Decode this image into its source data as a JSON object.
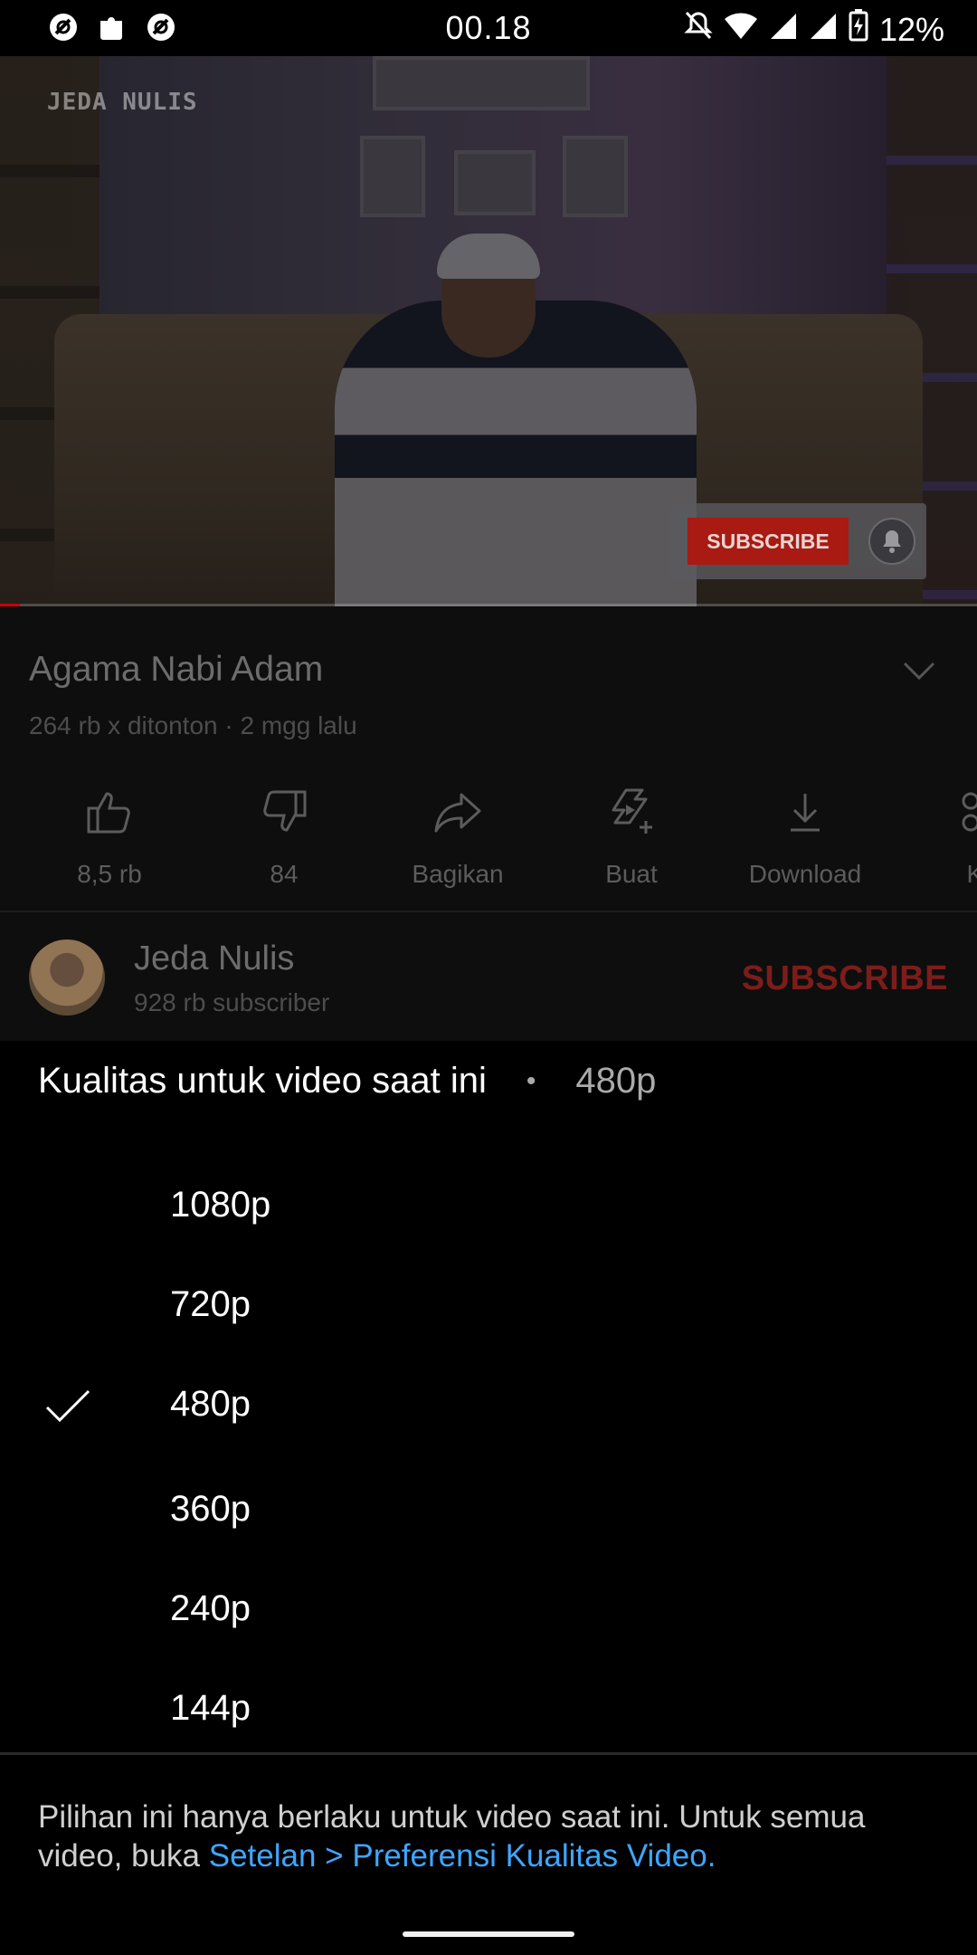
{
  "status_bar": {
    "time": "00.18",
    "battery": "12%",
    "icons": [
      "opera-icon",
      "extension-icon",
      "opera-icon",
      "mute-icon",
      "wifi-icon",
      "signal-icon",
      "signal-icon",
      "battery-charging-icon"
    ]
  },
  "video": {
    "watermark": "JEDA NULIS",
    "overlay_subscribe": "SUBSCRIBE",
    "progress_fraction": 0.02
  },
  "details": {
    "title": "Agama Nabi Adam",
    "meta": "264 rb x ditonton · 2 mgg lalu",
    "actions": [
      {
        "icon": "thumbs-up-icon",
        "label": "8,5 rb"
      },
      {
        "icon": "thumbs-down-icon",
        "label": "84"
      },
      {
        "icon": "share-icon",
        "label": "Bagikan"
      },
      {
        "icon": "create-icon",
        "label": "Buat"
      },
      {
        "icon": "download-icon",
        "label": "Download"
      },
      {
        "icon": "clip-icon",
        "label": "Kl"
      }
    ],
    "channel_name": "Jeda Nulis",
    "channel_subs": "928 rb subscriber",
    "subscribe_label": "SUBSCRIBE"
  },
  "quality_sheet": {
    "header_label": "Kualitas untuk video saat ini",
    "separator": "•",
    "current": "480p",
    "options": [
      {
        "label": "1080p",
        "selected": false
      },
      {
        "label": "720p",
        "selected": false
      },
      {
        "label": "480p",
        "selected": true
      },
      {
        "label": "360p",
        "selected": false
      },
      {
        "label": "240p",
        "selected": false
      },
      {
        "label": "144p",
        "selected": false
      }
    ],
    "footer_text": "Pilihan ini hanya berlaku untuk video saat ini. Untuk semua video, buka ",
    "footer_link": "Setelan > Preferensi Kualitas Video."
  },
  "colors": {
    "accent_link": "#3ea6ff",
    "subscribe_red": "#cc0000"
  }
}
